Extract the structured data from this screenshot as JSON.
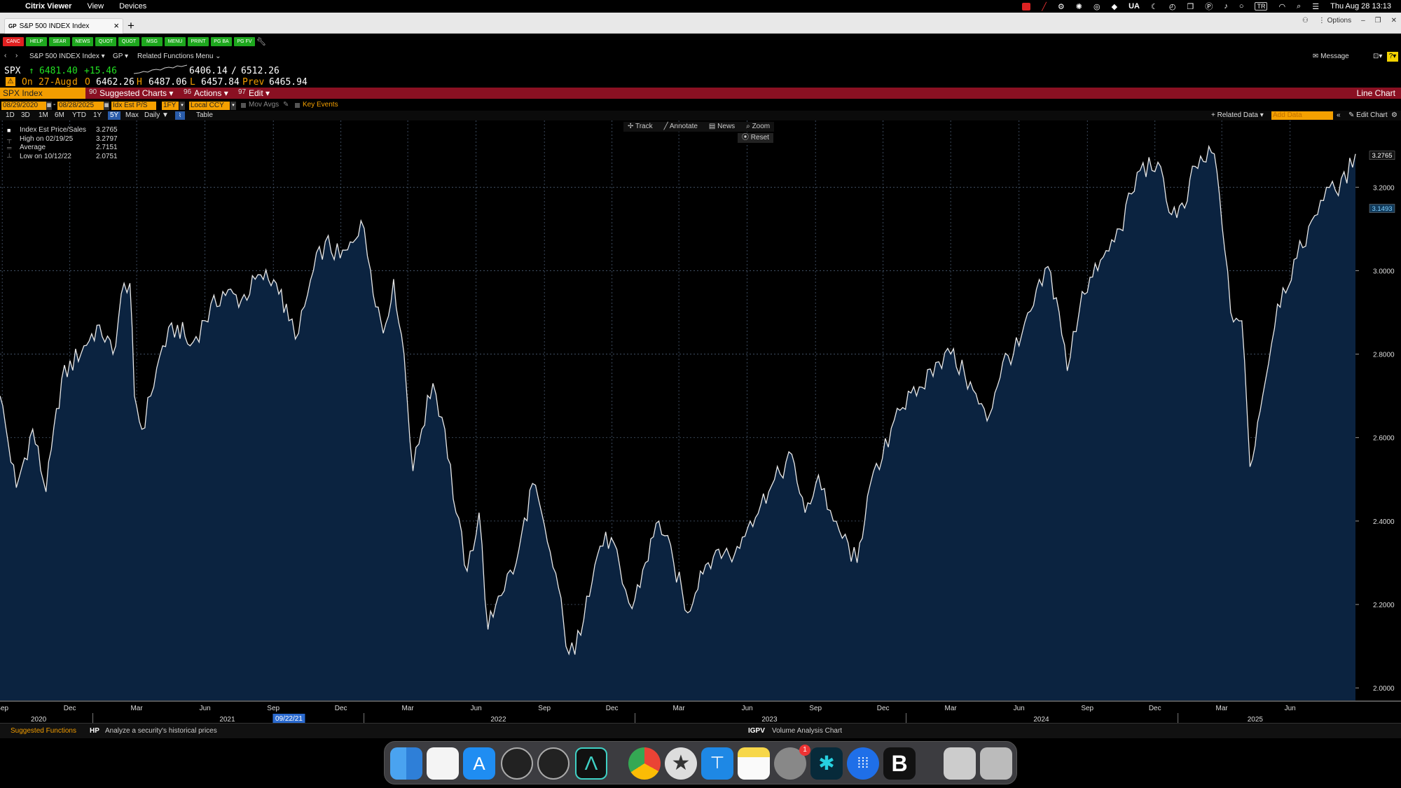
{
  "menubar": {
    "app": "Citrix Viewer",
    "items": [
      "View",
      "Devices"
    ],
    "status_ua": "UA",
    "status_tr": "TR",
    "clock": "Thu Aug 28  13:13"
  },
  "browser": {
    "tab_tag": "GP",
    "tab_title": "S&P 500 INDEX Index",
    "options": "Options"
  },
  "fn_buttons": [
    {
      "label": "CANC",
      "color": "#e02020"
    },
    {
      "label": "HELP",
      "color": "#1ea81e"
    },
    {
      "label": "SEAR",
      "color": "#1ea81e"
    },
    {
      "label": "NEWS",
      "color": "#1ea81e"
    },
    {
      "label": "QUOT",
      "color": "#1ea81e"
    },
    {
      "label": "QUOT",
      "color": "#1ea81e"
    },
    {
      "label": "MSG",
      "color": "#1ea81e"
    },
    {
      "label": "MENU",
      "color": "#1ea81e"
    },
    {
      "label": "PRINT",
      "color": "#1ea81e"
    },
    {
      "label": "PG BA",
      "color": "#1ea81e"
    },
    {
      "label": "PG FV",
      "color": "#1ea81e"
    }
  ],
  "nav": {
    "security": "S&P 500 INDEX Index",
    "function": "GP",
    "related": "Related Functions Menu",
    "message": "Message"
  },
  "quote": {
    "ticker": "SPX",
    "arrow": "↑",
    "price": "6481.40",
    "change": "+15.46",
    "range_low": "6406.14",
    "range_sep": "/",
    "range_high": "6512.26",
    "on_label": "On",
    "on_date": "27-Aug",
    "d_label": "d",
    "o_label": "O",
    "open": "6462.26",
    "h_label": "H",
    "high": "6487.06",
    "l_label": "L",
    "low": "6457.84",
    "prev_label": "Prev",
    "prev": "6465.94"
  },
  "toolbar": {
    "security": "SPX Index",
    "suggested_num": "90",
    "suggested": "Suggested Charts",
    "actions_num": "96",
    "actions": "Actions",
    "edit_num": "97",
    "edit": "Edit",
    "chart_type": "Line Chart"
  },
  "params": {
    "start": "08/29/2020",
    "end": "08/28/2025",
    "field": "Idx Est P/S",
    "period": "1FY",
    "currency": "Local CCY",
    "mov_avgs": "Mov Avgs",
    "key_events": "Key Events"
  },
  "periods": [
    "1D",
    "3D",
    "1M",
    "6M",
    "YTD",
    "1Y",
    "5Y",
    "Max"
  ],
  "period_active": "5Y",
  "frequency": "Daily",
  "table_label": "Table",
  "right_tools": {
    "related": "Related Data",
    "add_data": "Add Data",
    "edit_chart": "Edit Chart"
  },
  "chart_tools": {
    "track": "Track",
    "annotate": "Annotate",
    "news": "News",
    "zoom": "Zoom",
    "reset": "Reset"
  },
  "legend": [
    {
      "label": "Index Est Price/Sales",
      "value": "3.2765"
    },
    {
      "label": "High on 02/19/25",
      "value": "3.2797"
    },
    {
      "label": "Average",
      "value": "2.7151"
    },
    {
      "label": "Low on 10/12/22",
      "value": "2.0751"
    }
  ],
  "chart_data": {
    "type": "area",
    "ylim": [
      1.97,
      3.36
    ],
    "y_ticks": [
      "2.0000",
      "2.2000",
      "2.4000",
      "2.6000",
      "2.8000",
      "3.0000",
      "3.2000"
    ],
    "last_value": "3.2765",
    "ref_value": "3.1493",
    "x_start": "2020-08-29",
    "x_end": "2025-08-28",
    "month_ticks": [
      {
        "label": "Sep",
        "date": "2020-09-01"
      },
      {
        "label": "Dec",
        "date": "2020-12-01"
      },
      {
        "label": "Mar",
        "date": "2021-03-01"
      },
      {
        "label": "Jun",
        "date": "2021-06-01"
      },
      {
        "label": "Sep",
        "date": "2021-09-01"
      },
      {
        "label": "Dec",
        "date": "2021-12-01"
      },
      {
        "label": "Mar",
        "date": "2022-03-01"
      },
      {
        "label": "Jun",
        "date": "2022-06-01"
      },
      {
        "label": "Sep",
        "date": "2022-09-01"
      },
      {
        "label": "Dec",
        "date": "2022-12-01"
      },
      {
        "label": "Mar",
        "date": "2023-03-01"
      },
      {
        "label": "Jun",
        "date": "2023-06-01"
      },
      {
        "label": "Sep",
        "date": "2023-09-01"
      },
      {
        "label": "Dec",
        "date": "2023-12-01"
      },
      {
        "label": "Mar",
        "date": "2024-03-01"
      },
      {
        "label": "Jun",
        "date": "2024-06-01"
      },
      {
        "label": "Sep",
        "date": "2024-09-01"
      },
      {
        "label": "Dec",
        "date": "2024-12-01"
      },
      {
        "label": "Mar",
        "date": "2025-03-01"
      },
      {
        "label": "Jun",
        "date": "2025-06-01"
      }
    ],
    "year_ticks": [
      {
        "label": "2020",
        "date": "2020-10-20"
      },
      {
        "label": "2021",
        "date": "2021-07-01"
      },
      {
        "label": "2022",
        "date": "2022-07-01"
      },
      {
        "label": "2023",
        "date": "2023-07-01"
      },
      {
        "label": "2024",
        "date": "2024-07-01"
      },
      {
        "label": "2025",
        "date": "2025-04-15"
      }
    ],
    "cursor_date_label": "09/22/21",
    "cursor_date": "2021-09-22",
    "series": [
      {
        "x": "2020-08-29",
        "y": 2.7
      },
      {
        "x": "2020-09-20",
        "y": 2.48
      },
      {
        "x": "2020-10-12",
        "y": 2.62
      },
      {
        "x": "2020-10-30",
        "y": 2.47
      },
      {
        "x": "2020-11-20",
        "y": 2.74
      },
      {
        "x": "2020-12-20",
        "y": 2.82
      },
      {
        "x": "2021-01-10",
        "y": 2.87
      },
      {
        "x": "2021-01-28",
        "y": 2.8
      },
      {
        "x": "2021-02-12",
        "y": 2.97
      },
      {
        "x": "2021-02-20",
        "y": 2.97
      },
      {
        "x": "2021-02-26",
        "y": 2.7
      },
      {
        "x": "2021-03-08",
        "y": 2.62
      },
      {
        "x": "2021-03-20",
        "y": 2.7
      },
      {
        "x": "2021-04-05",
        "y": 2.82
      },
      {
        "x": "2021-04-25",
        "y": 2.87
      },
      {
        "x": "2021-05-12",
        "y": 2.82
      },
      {
        "x": "2021-06-01",
        "y": 2.88
      },
      {
        "x": "2021-06-25",
        "y": 2.95
      },
      {
        "x": "2021-07-20",
        "y": 2.93
      },
      {
        "x": "2021-08-15",
        "y": 2.99
      },
      {
        "x": "2021-09-05",
        "y": 2.97
      },
      {
        "x": "2021-09-22",
        "y": 2.88
      },
      {
        "x": "2021-10-05",
        "y": 2.85
      },
      {
        "x": "2021-10-25",
        "y": 3.0
      },
      {
        "x": "2021-11-10",
        "y": 3.07
      },
      {
        "x": "2021-11-30",
        "y": 3.03
      },
      {
        "x": "2021-12-10",
        "y": 3.05
      },
      {
        "x": "2021-12-28",
        "y": 3.12
      },
      {
        "x": "2022-01-10",
        "y": 3.0
      },
      {
        "x": "2022-01-27",
        "y": 2.85
      },
      {
        "x": "2022-02-10",
        "y": 2.98
      },
      {
        "x": "2022-02-24",
        "y": 2.8
      },
      {
        "x": "2022-03-08",
        "y": 2.52
      },
      {
        "x": "2022-03-20",
        "y": 2.62
      },
      {
        "x": "2022-04-04",
        "y": 2.73
      },
      {
        "x": "2022-04-20",
        "y": 2.62
      },
      {
        "x": "2022-05-05",
        "y": 2.42
      },
      {
        "x": "2022-05-20",
        "y": 2.28
      },
      {
        "x": "2022-06-05",
        "y": 2.42
      },
      {
        "x": "2022-06-17",
        "y": 2.14
      },
      {
        "x": "2022-07-01",
        "y": 2.22
      },
      {
        "x": "2022-07-25",
        "y": 2.3
      },
      {
        "x": "2022-08-16",
        "y": 2.49
      },
      {
        "x": "2022-09-05",
        "y": 2.35
      },
      {
        "x": "2022-09-20",
        "y": 2.24
      },
      {
        "x": "2022-09-30",
        "y": 2.1
      },
      {
        "x": "2022-10-12",
        "y": 2.08
      },
      {
        "x": "2022-10-28",
        "y": 2.22
      },
      {
        "x": "2022-11-15",
        "y": 2.34
      },
      {
        "x": "2022-11-30",
        "y": 2.36
      },
      {
        "x": "2022-12-15",
        "y": 2.25
      },
      {
        "x": "2022-12-28",
        "y": 2.19
      },
      {
        "x": "2023-01-15",
        "y": 2.3
      },
      {
        "x": "2023-02-02",
        "y": 2.4
      },
      {
        "x": "2023-02-22",
        "y": 2.3
      },
      {
        "x": "2023-03-13",
        "y": 2.18
      },
      {
        "x": "2023-03-30",
        "y": 2.28
      },
      {
        "x": "2023-04-20",
        "y": 2.33
      },
      {
        "x": "2023-05-15",
        "y": 2.32
      },
      {
        "x": "2023-06-05",
        "y": 2.4
      },
      {
        "x": "2023-06-30",
        "y": 2.47
      },
      {
        "x": "2023-07-31",
        "y": 2.56
      },
      {
        "x": "2023-08-18",
        "y": 2.42
      },
      {
        "x": "2023-09-05",
        "y": 2.51
      },
      {
        "x": "2023-09-25",
        "y": 2.4
      },
      {
        "x": "2023-10-27",
        "y": 2.3
      },
      {
        "x": "2023-11-10",
        "y": 2.46
      },
      {
        "x": "2023-11-30",
        "y": 2.55
      },
      {
        "x": "2023-12-20",
        "y": 2.67
      },
      {
        "x": "2024-01-15",
        "y": 2.7
      },
      {
        "x": "2024-02-10",
        "y": 2.78
      },
      {
        "x": "2024-03-01",
        "y": 2.8
      },
      {
        "x": "2024-03-20",
        "y": 2.75
      },
      {
        "x": "2024-04-19",
        "y": 2.64
      },
      {
        "x": "2024-05-10",
        "y": 2.78
      },
      {
        "x": "2024-06-01",
        "y": 2.82
      },
      {
        "x": "2024-07-10",
        "y": 3.01
      },
      {
        "x": "2024-07-25",
        "y": 2.9
      },
      {
        "x": "2024-08-05",
        "y": 2.76
      },
      {
        "x": "2024-08-25",
        "y": 2.95
      },
      {
        "x": "2024-09-15",
        "y": 3.0
      },
      {
        "x": "2024-10-15",
        "y": 3.1
      },
      {
        "x": "2024-11-11",
        "y": 3.24
      },
      {
        "x": "2024-12-05",
        "y": 3.26
      },
      {
        "x": "2024-12-20",
        "y": 3.14
      },
      {
        "x": "2025-01-10",
        "y": 3.15
      },
      {
        "x": "2025-01-24",
        "y": 3.25
      },
      {
        "x": "2025-02-19",
        "y": 3.28
      },
      {
        "x": "2025-03-05",
        "y": 3.05
      },
      {
        "x": "2025-03-13",
        "y": 2.9
      },
      {
        "x": "2025-03-28",
        "y": 2.88
      },
      {
        "x": "2025-04-08",
        "y": 2.53
      },
      {
        "x": "2025-04-25",
        "y": 2.7
      },
      {
        "x": "2025-05-15",
        "y": 2.92
      },
      {
        "x": "2025-06-10",
        "y": 3.03
      },
      {
        "x": "2025-06-30",
        "y": 3.12
      },
      {
        "x": "2025-07-20",
        "y": 3.2
      },
      {
        "x": "2025-08-05",
        "y": 3.18
      },
      {
        "x": "2025-08-28",
        "y": 3.28
      }
    ]
  },
  "suggested_functions": {
    "label": "Suggested Functions",
    "items": [
      {
        "code": "HP",
        "desc": "Analyze a security's historical prices"
      },
      {
        "code": "IGPV",
        "desc": "Volume Analysis Chart"
      }
    ]
  }
}
